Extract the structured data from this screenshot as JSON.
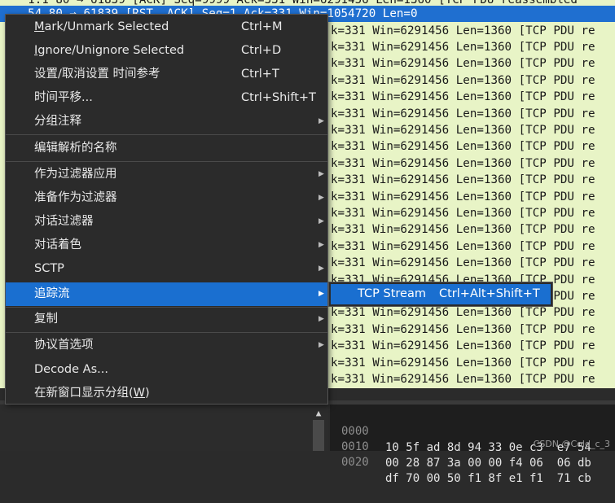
{
  "packet_list": {
    "top_rows": [
      "    1.1 80 → 61839 [ACK] Seq=9999 Ack=331 Win=6291456 Len=1360 [TCP PDU reassembled",
      "    54 80 → 61839 [RST, ACK] Seq=1 Ack=331 Win=1054720 Len=0"
    ],
    "row_text": "k=331 Win=6291456 Len=1360 [TCP PDU re",
    "row_count": 22
  },
  "context_menu": {
    "items": [
      {
        "label_pre": "",
        "label_u": "M",
        "label_post": "ark/Unmark Selected",
        "shortcut": "Ctrl+M",
        "submenu": false
      },
      {
        "label_pre": "",
        "label_u": "I",
        "label_post": "gnore/Unignore Selected",
        "shortcut": "Ctrl+D",
        "submenu": false
      },
      {
        "label_pre": "设置/取消设置 时间参考",
        "label_u": "",
        "label_post": "",
        "shortcut": "Ctrl+T",
        "submenu": false
      },
      {
        "label_pre": "时间平移...",
        "label_u": "",
        "label_post": "",
        "shortcut": "Ctrl+Shift+T",
        "submenu": false
      },
      {
        "label_pre": "分组注释",
        "label_u": "",
        "label_post": "",
        "shortcut": "",
        "submenu": true
      },
      {
        "label_pre": "编辑解析的名称",
        "label_u": "",
        "label_post": "",
        "shortcut": "",
        "submenu": false
      },
      {
        "label_pre": "作为过滤器应用",
        "label_u": "",
        "label_post": "",
        "shortcut": "",
        "submenu": true
      },
      {
        "label_pre": "准备作为过滤器",
        "label_u": "",
        "label_post": "",
        "shortcut": "",
        "submenu": true
      },
      {
        "label_pre": "对话过滤器",
        "label_u": "",
        "label_post": "",
        "shortcut": "",
        "submenu": true
      },
      {
        "label_pre": "对话着色",
        "label_u": "",
        "label_post": "",
        "shortcut": "",
        "submenu": true
      },
      {
        "label_pre": "SCTP",
        "label_u": "",
        "label_post": "",
        "shortcut": "",
        "submenu": true
      },
      {
        "label_pre": "追踪流",
        "label_u": "",
        "label_post": "",
        "shortcut": "",
        "submenu": true
      },
      {
        "label_pre": "复制",
        "label_u": "",
        "label_post": "",
        "shortcut": "",
        "submenu": true
      },
      {
        "label_pre": "协议首选项",
        "label_u": "",
        "label_post": "",
        "shortcut": "",
        "submenu": true
      },
      {
        "label_pre": "Decode As...",
        "label_u": "",
        "label_post": "",
        "shortcut": "",
        "submenu": false
      },
      {
        "label_pre": "在新窗口显示分组(",
        "label_u": "W",
        "label_post": ")",
        "shortcut": "",
        "submenu": false
      }
    ]
  },
  "submenu": {
    "label": "TCP Stream",
    "shortcut": "Ctrl+Alt+Shift+T"
  },
  "hex_pane": {
    "rows": [
      {
        "offset": "0000",
        "bytes": "10 5f ad 8d 94 33 0e c3  e7 54"
      },
      {
        "offset": "0010",
        "bytes": "00 28 87 3a 00 00 f4 06  06 db"
      },
      {
        "offset": "0020",
        "bytes": "df 70 00 50 f1 8f e1 f1  71 cb"
      }
    ]
  },
  "watermark": "CSDN @Cold_c_3",
  "colors": {
    "packet_bg": "#e8f4c6",
    "selected_row": "#1f6fd0",
    "menu_bg": "#2b2b2b",
    "menu_active": "#1a6fd0"
  }
}
